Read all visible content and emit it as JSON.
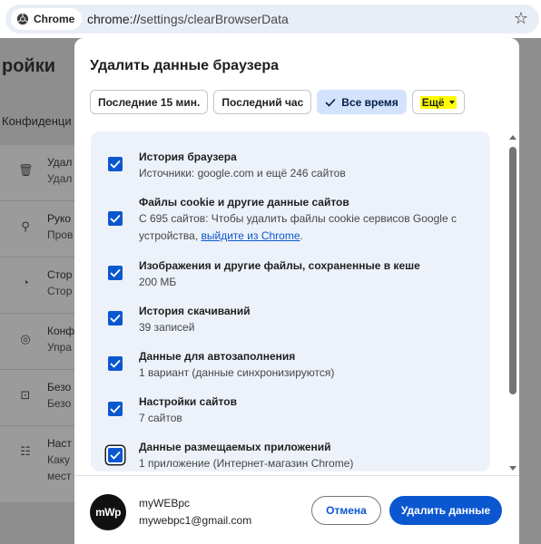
{
  "browser": {
    "chip_label": "Chrome",
    "url_scheme": "chrome://",
    "url_path": "settings/clearBrowserData"
  },
  "background": {
    "title": "ройки",
    "section": "Конфиденци",
    "rows": [
      {
        "icon": "trash-icon",
        "t1": "Удал",
        "t2": "Удал"
      },
      {
        "icon": "guide-icon",
        "t1": "Руко",
        "t2": "Пров"
      },
      {
        "icon": "cookie-icon",
        "t1": "Стор",
        "t2": "Стор"
      },
      {
        "icon": "ads-icon",
        "t1": "Конф",
        "t2": "Упра"
      },
      {
        "icon": "lock-icon",
        "t1": "Безо",
        "t2": "Безо"
      },
      {
        "icon": "sliders-icon",
        "t1": "Наст",
        "t2": "Каку",
        "t3": "мест"
      }
    ]
  },
  "dialog": {
    "title": "Удалить данные браузера",
    "tabs": [
      {
        "label": "Последние 15 мин."
      },
      {
        "label": "Последний час"
      },
      {
        "label": "Все время",
        "active": true
      },
      {
        "label": "Ещё"
      }
    ],
    "items": [
      {
        "title": "История браузера",
        "desc": "Источники: google.com и ещё 246 сайтов",
        "checked": true
      },
      {
        "title": "Файлы cookie и другие данные сайтов",
        "desc": "С 695 сайтов: Чтобы удалить файлы cookie сервисов Google с",
        "desc2_prefix": "устройства, ",
        "desc2_link": "выйдите из Chrome",
        "desc2_suffix": ".",
        "checked": true
      },
      {
        "title": "Изображения и другие файлы, сохраненные в кеше",
        "desc": "200 МБ",
        "checked": true
      },
      {
        "title": "История скачиваний",
        "desc": "39 записей",
        "checked": true
      },
      {
        "title": "Данные для автозаполнения",
        "desc": "1 вариант (данные синхронизируются)",
        "checked": true
      },
      {
        "title": "Настройки сайтов",
        "desc": "7 сайтов",
        "checked": true
      },
      {
        "title": "Данные размещаемых приложений",
        "desc": "1 приложение (Интернет-магазин Chrome)",
        "checked": true
      }
    ],
    "account": {
      "avatar_text": "mWp",
      "name": "myWEBpc",
      "email": "mywebpc1@gmail.com"
    },
    "cancel_label": "Отмена",
    "delete_label": "Удалить данные"
  },
  "colors": {
    "accent": "#0b57d0",
    "list_bg": "#edf2fa",
    "active_tab": "#d3e3fd",
    "highlight": "#ffff00"
  }
}
